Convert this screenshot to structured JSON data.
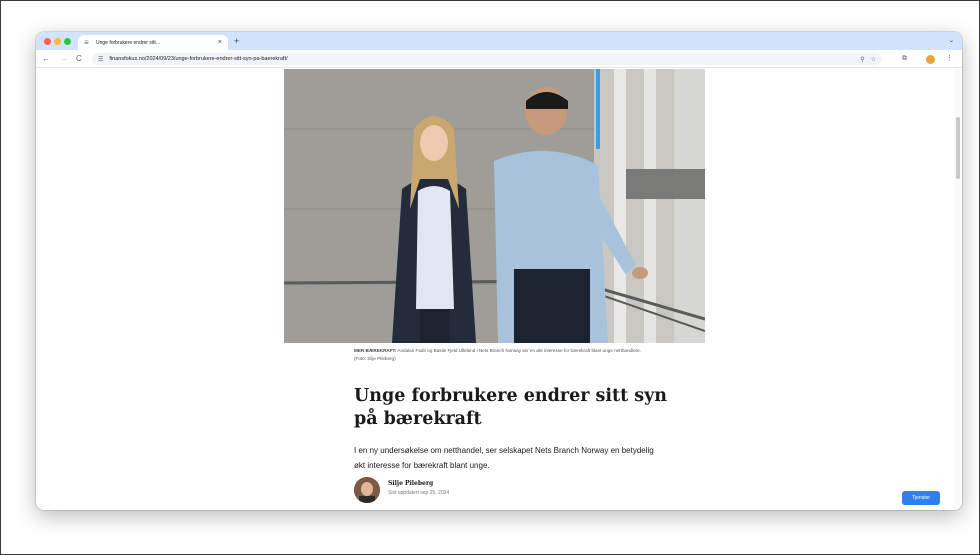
{
  "browser": {
    "tab_title": "Unge forbrukere endrer sitt…",
    "tab_close": "×",
    "new_tab": "+",
    "url": "finansfokus.no/2024/09/23/unge-forbrukere-endrer-sitt-syn-pa-baerekraft/"
  },
  "article": {
    "caption_bold": "MER BÆREKRAFT:",
    "caption_rest": "Andalan Fadir og Basile Fjeld Ulleland i Nets Branch Norway ser en økt interesse for bærekraft blant unge netthandlere. (Foto: Silje Pileberg)",
    "headline": "Unge forbrukere endrer sitt syn på bærekraft",
    "lead": "I en ny undersøkelse om netthandel, ser selskapet Nets Branch Norway en betydelig økt interesse for bærekraft blant unge.",
    "author_name": "Silje Pileberg",
    "updated": "Sist oppdatert sep 25, 2024",
    "cta_label": "Tjenster"
  },
  "icons": {
    "back": "←",
    "forward": "→",
    "reload": "C",
    "site_info": "☰",
    "zoom": "⚲",
    "star": "☆",
    "extensions": "⧉",
    "menu": "⋮",
    "chevron": "⌄"
  },
  "colors": {
    "tab_strip": "#d3e3fd",
    "cta": "#2f80ed"
  }
}
